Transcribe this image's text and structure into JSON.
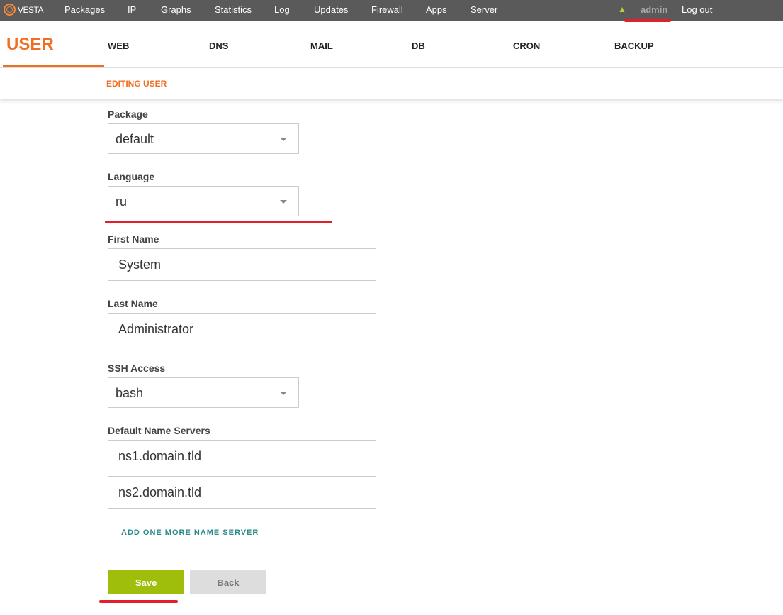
{
  "topbar": {
    "logo": "VESTA",
    "nav": [
      "Packages",
      "IP",
      "Graphs",
      "Statistics",
      "Log",
      "Updates",
      "Firewall",
      "Apps",
      "Server"
    ],
    "user": "admin",
    "logout": "Log out"
  },
  "tabs": {
    "active": "USER",
    "items": [
      "WEB",
      "DNS",
      "MAIL",
      "DB",
      "CRON",
      "BACKUP"
    ]
  },
  "subtitle": "EDITING USER",
  "form": {
    "package_label": "Package",
    "package_value": "default",
    "language_label": "Language",
    "language_value": "ru",
    "first_name_label": "First Name",
    "first_name_value": "System",
    "last_name_label": "Last Name",
    "last_name_value": "Administrator",
    "ssh_label": "SSH Access",
    "ssh_value": "bash",
    "ns_label": "Default Name Servers",
    "ns1": "ns1.domain.tld",
    "ns2": "ns2.domain.tld",
    "add_ns": "ADD ONE MORE NAME SERVER",
    "save": "Save",
    "back": "Back"
  },
  "colors": {
    "accent": "#f06f22",
    "save": "#9fbe0b",
    "annotation": "#e0202a"
  }
}
